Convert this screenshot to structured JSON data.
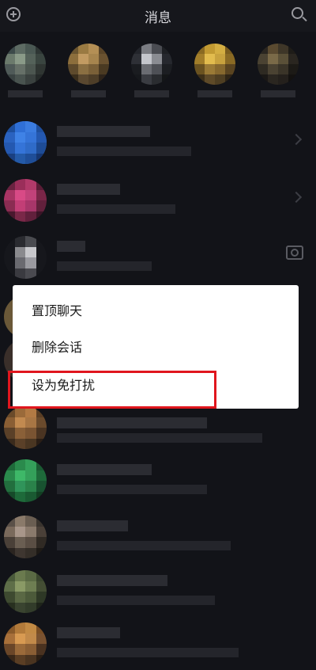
{
  "header": {
    "title": "消息"
  },
  "context_menu": {
    "items": [
      {
        "label": "置顶聊天"
      },
      {
        "label": "删除会话"
      },
      {
        "label": "设为免打扰"
      }
    ]
  },
  "colors": {
    "background": "#121318",
    "menu_bg": "#ffffff",
    "highlight": "#e0161e"
  }
}
